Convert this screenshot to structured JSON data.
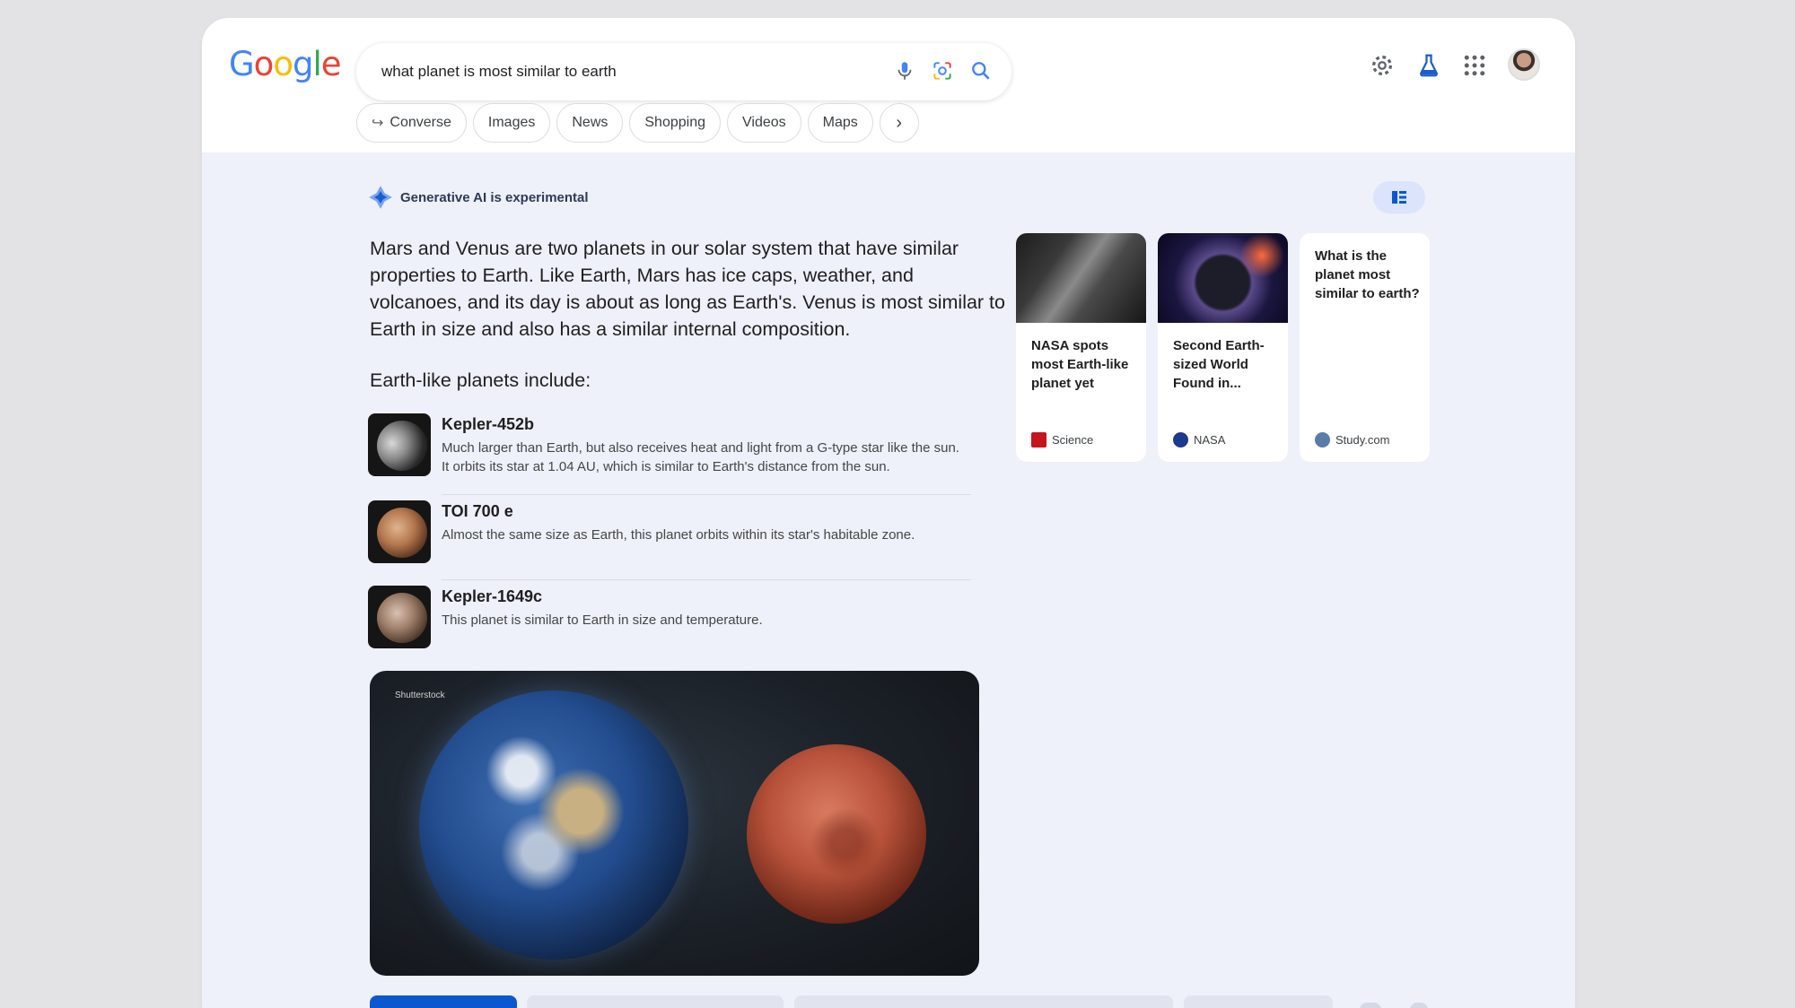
{
  "logo": {
    "text": "Google",
    "letters": [
      "G",
      "o",
      "o",
      "g",
      "l",
      "e"
    ],
    "colors": [
      "#4285F4",
      "#EA4335",
      "#FBBC05",
      "#4285F4",
      "#34A853",
      "#EA4335"
    ]
  },
  "search": {
    "query": "what planet is most similar to earth"
  },
  "header_icons": [
    "mic-icon",
    "lens-icon",
    "search-icon",
    "gear-icon",
    "labs-flask-icon",
    "apps-grid-icon",
    "avatar"
  ],
  "chips": [
    {
      "label": "Converse",
      "icon": "converse-arrow-icon"
    },
    {
      "label": "Images"
    },
    {
      "label": "News"
    },
    {
      "label": "Shopping"
    },
    {
      "label": "Videos"
    },
    {
      "label": "Maps"
    }
  ],
  "ai": {
    "badge": "Generative AI is experimental",
    "summary": "Mars and Venus are two planets in our solar system that have similar properties to Earth. Like Earth, Mars has ice caps, weather, and volcanoes, and its day is about as long as Earth's. Venus is most similar to Earth in size and also has a similar internal composition.",
    "list_heading": "Earth-like planets include:",
    "planets": [
      {
        "name": "Kepler-452b",
        "desc": "Much larger than Earth, but also receives heat and light from a G-type star like the sun. It orbits its star at 1.04 AU, which is similar to Earth's distance from the sun."
      },
      {
        "name": "TOI 700 e",
        "desc": "Almost the same size as Earth, this planet orbits within its star's habitable zone."
      },
      {
        "name": "Kepler-1649c",
        "desc": "This planet is similar to Earth in size and temperature."
      }
    ],
    "image_credit": "Shutterstock"
  },
  "cards": [
    {
      "title": "NASA spots most Earth-like planet yet",
      "source": "Science",
      "source_color": "#c4161c"
    },
    {
      "title": "Second Earth-sized World Found in...",
      "source": "NASA",
      "source_color": "#1b3a8c"
    },
    {
      "title": "What is the planet most similar to earth?",
      "source": "Study.com",
      "source_color": "#5a7ca8"
    }
  ],
  "colors": {
    "accent": "#0b57d0",
    "panel": "#eef0fa",
    "page": "#e3e3e5"
  }
}
